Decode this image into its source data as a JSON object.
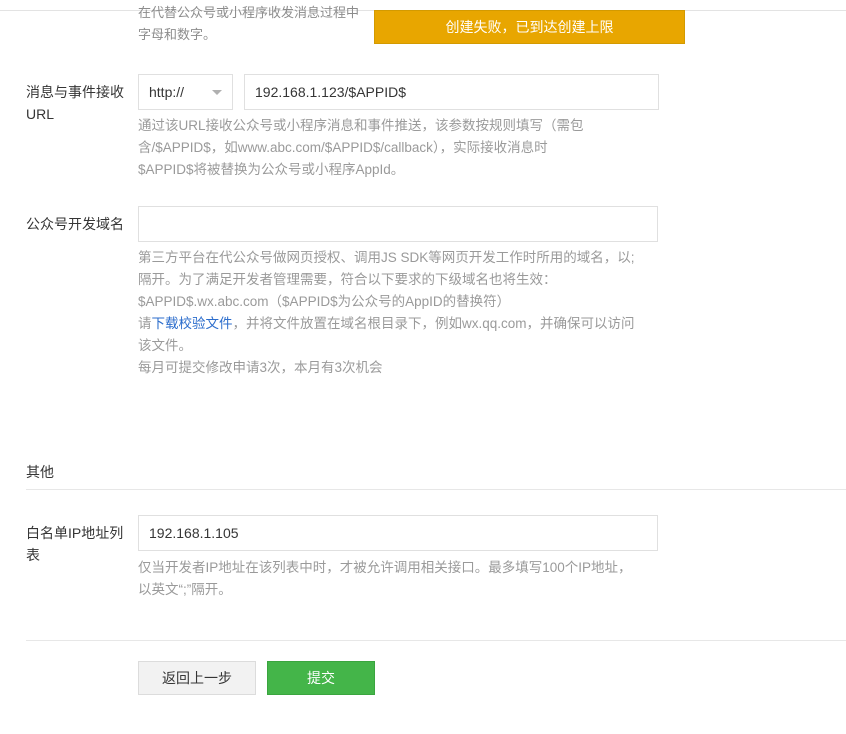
{
  "top": {
    "cut_line1": "在代替公众号或小程序收发消息过程中",
    "cut_line2": "字母和数字。"
  },
  "toast": {
    "message": "创建失败，已到达创建上限"
  },
  "msg_url": {
    "label": "消息与事件接收URL",
    "protocol": "http://",
    "value": "192.168.1.123/$APPID$",
    "hint_lines": [
      "通过该URL接收公众号或小程序消息和事件推送，该参数按规则填写（需包",
      "含/$APPID$，如www.abc.com/$APPID$/callback），实际接收消息时",
      "$APPID$将被替换为公众号或小程序AppId。"
    ]
  },
  "domain": {
    "label": "公众号开发域名",
    "value": "",
    "hint_lines": [
      "第三方平台在代公众号做网页授权、调用JS SDK等网页开发工作时所用的域名，以;",
      "隔开。为了满足开发者管理需要，符合以下要求的下级域名也将生效：",
      "$APPID$.wx.abc.com（$APPID$为公众号的AppID的替换符）"
    ],
    "hint_prefix": "请",
    "hint_link": "下载校验文件",
    "hint_suffix": "，并将文件放置在域名根目录下，例如wx.qq.com，并确保可以访问",
    "hint_tail_lines": [
      "该文件。",
      "每月可提交修改申请3次，本月有3次机会"
    ]
  },
  "other": {
    "section_title": "其他",
    "whitelist_label": "白名单IP地址列表",
    "whitelist_value": "192.168.1.105",
    "whitelist_hint_lines": [
      "仅当开发者IP地址在该列表中时，才被允许调用相关接口。最多填写100个IP地址，",
      "以英文“;”隔开。"
    ]
  },
  "buttons": {
    "back": "返回上一步",
    "submit": "提交"
  }
}
